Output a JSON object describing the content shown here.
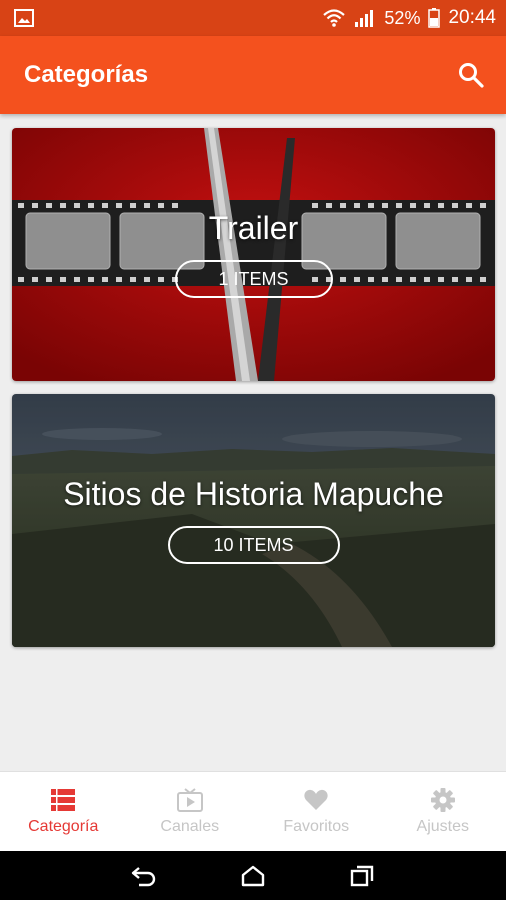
{
  "status_bar": {
    "battery": "52%",
    "time": "20:44",
    "icons": [
      "gallery-icon",
      "wifi-icon",
      "signal-icon",
      "battery-icon"
    ]
  },
  "app_bar": {
    "title": "Categorías",
    "search_icon": "search-icon"
  },
  "categories": [
    {
      "title": "Trailer",
      "count": "1 ITEMS"
    },
    {
      "title": "Sitios de Historia Mapuche",
      "count": "10 ITEMS"
    }
  ],
  "bottom_nav": {
    "items": [
      {
        "label": "Categoría",
        "icon": "list-icon",
        "active": true
      },
      {
        "label": "Canales",
        "icon": "tv-icon",
        "active": false
      },
      {
        "label": "Favoritos",
        "icon": "heart-icon",
        "active": false
      },
      {
        "label": "Ajustes",
        "icon": "gear-icon",
        "active": false
      }
    ]
  },
  "colors": {
    "status_bar": "#d84315",
    "app_bar": "#f4511e",
    "active": "#e53935",
    "inactive": "#c6c6c6"
  },
  "system_nav": [
    "back-icon",
    "home-icon",
    "recents-icon"
  ]
}
